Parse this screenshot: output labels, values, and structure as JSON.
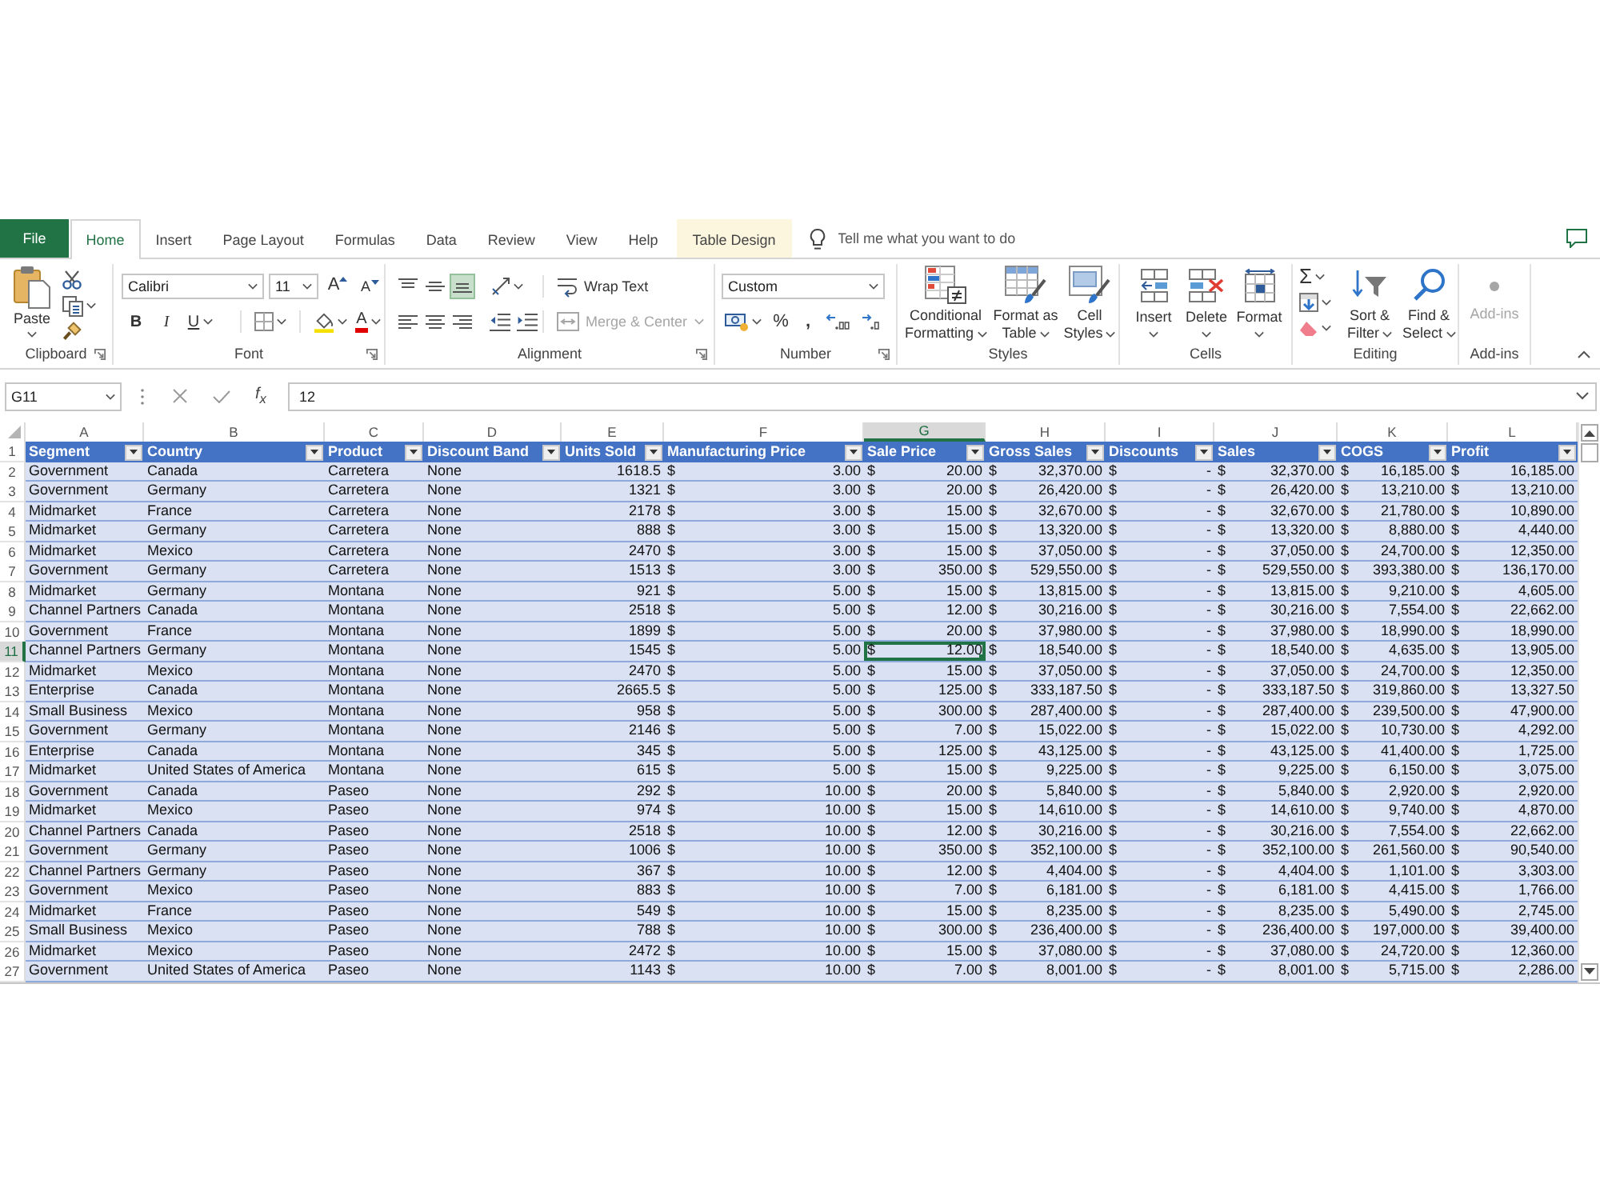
{
  "tabs": [
    {
      "label": "File",
      "kind": "file",
      "selected": false
    },
    {
      "label": "Home",
      "kind": "standard",
      "selected": true
    },
    {
      "label": "Insert",
      "kind": "standard",
      "selected": false
    },
    {
      "label": "Page Layout",
      "kind": "standard",
      "selected": false
    },
    {
      "label": "Formulas",
      "kind": "standard",
      "selected": false
    },
    {
      "label": "Data",
      "kind": "standard",
      "selected": false
    },
    {
      "label": "Review",
      "kind": "standard",
      "selected": false
    },
    {
      "label": "View",
      "kind": "standard",
      "selected": false
    },
    {
      "label": "Help",
      "kind": "standard",
      "selected": false
    },
    {
      "label": "Table Design",
      "kind": "contextual",
      "selected": false
    }
  ],
  "tell_me": {
    "placeholder": "Tell me what you want to do"
  },
  "ribbon": {
    "clipboard": {
      "label": "Clipboard",
      "paste": "Paste"
    },
    "font": {
      "label": "Font",
      "font_name": "Calibri",
      "font_size": "11",
      "grow_font": "A",
      "shrink_font": "A",
      "bold": "B",
      "italic": "I",
      "underline": "U",
      "font_color": "A"
    },
    "alignment": {
      "label": "Alignment",
      "vertical": [
        {
          "selected": false
        },
        {
          "selected": false
        },
        {
          "selected": true
        }
      ],
      "horizontal": [
        {
          "selected": false
        },
        {
          "selected": false
        },
        {
          "selected": false
        }
      ],
      "wrap_text": "Wrap Text",
      "merge_center": {
        "label": "Merge & Center",
        "disabled": true
      }
    },
    "number": {
      "label": "Number",
      "format": "Custom",
      "percent": "%",
      "comma": ","
    },
    "styles": {
      "label": "Styles",
      "buttons": [
        "Conditional Formatting",
        "Format as Table",
        "Cell Styles"
      ]
    },
    "cells": {
      "label": "Cells",
      "buttons": [
        "Insert",
        "Delete",
        "Format"
      ]
    },
    "editing": {
      "label": "Editing",
      "autosum": "Σ",
      "sort_filter": "Sort & Filter",
      "find_select": "Find & Select"
    },
    "add_ins": {
      "label": "Add-ins",
      "button": {
        "label": "Add-ins",
        "disabled": true
      }
    }
  },
  "formula_bar": {
    "name_box": "G11",
    "fx": "f$_{x}$",
    "formula": "12"
  },
  "sheet": {
    "columns": [
      {
        "letter": "A",
        "header": "Segment",
        "kind": "text",
        "selected": false
      },
      {
        "letter": "B",
        "header": "Country",
        "kind": "text",
        "selected": false
      },
      {
        "letter": "C",
        "header": "Product",
        "kind": "text",
        "selected": false
      },
      {
        "letter": "D",
        "header": "Discount Band",
        "kind": "text",
        "selected": false
      },
      {
        "letter": "E",
        "header": "Units Sold",
        "kind": "number",
        "selected": false
      },
      {
        "letter": "F",
        "header": "Manufacturing Price",
        "kind": "currency",
        "selected": false
      },
      {
        "letter": "G",
        "header": "Sale Price",
        "kind": "currency",
        "selected": true
      },
      {
        "letter": "H",
        "header": "Gross Sales",
        "kind": "currency",
        "selected": false
      },
      {
        "letter": "I",
        "header": "Discounts",
        "kind": "currency",
        "selected": false
      },
      {
        "letter": "J",
        "header": "Sales",
        "kind": "currency",
        "selected": false
      },
      {
        "letter": "K",
        "header": "COGS",
        "kind": "currency",
        "selected": false
      },
      {
        "letter": "L",
        "header": "Profit",
        "kind": "currency",
        "selected": false
      }
    ],
    "header_row_number": "1",
    "rows": [
      {
        "number": "2",
        "selected": false,
        "cells": [
          "Government",
          "Canada",
          "Carretera",
          "None",
          "1618.5",
          "$ 3.00",
          "$ 20.00",
          "$ 32,370.00",
          "$ -",
          "$ 32,370.00",
          "$ 16,185.00",
          "$ 16,185.00"
        ]
      },
      {
        "number": "3",
        "selected": false,
        "cells": [
          "Government",
          "Germany",
          "Carretera",
          "None",
          "1321",
          "$ 3.00",
          "$ 20.00",
          "$ 26,420.00",
          "$ -",
          "$ 26,420.00",
          "$ 13,210.00",
          "$ 13,210.00"
        ]
      },
      {
        "number": "4",
        "selected": false,
        "cells": [
          "Midmarket",
          "France",
          "Carretera",
          "None",
          "2178",
          "$ 3.00",
          "$ 15.00",
          "$ 32,670.00",
          "$ -",
          "$ 32,670.00",
          "$ 21,780.00",
          "$ 10,890.00"
        ]
      },
      {
        "number": "5",
        "selected": false,
        "cells": [
          "Midmarket",
          "Germany",
          "Carretera",
          "None",
          "888",
          "$ 3.00",
          "$ 15.00",
          "$ 13,320.00",
          "$ -",
          "$ 13,320.00",
          "$ 8,880.00",
          "$ 4,440.00"
        ]
      },
      {
        "number": "6",
        "selected": false,
        "cells": [
          "Midmarket",
          "Mexico",
          "Carretera",
          "None",
          "2470",
          "$ 3.00",
          "$ 15.00",
          "$ 37,050.00",
          "$ -",
          "$ 37,050.00",
          "$ 24,700.00",
          "$ 12,350.00"
        ]
      },
      {
        "number": "7",
        "selected": false,
        "cells": [
          "Government",
          "Germany",
          "Carretera",
          "None",
          "1513",
          "$ 3.00",
          "$ 350.00",
          "$ 529,550.00",
          "$ -",
          "$ 529,550.00",
          "$ 393,380.00",
          "$ 136,170.00"
        ]
      },
      {
        "number": "8",
        "selected": false,
        "cells": [
          "Midmarket",
          "Germany",
          "Montana",
          "None",
          "921",
          "$ 5.00",
          "$ 15.00",
          "$ 13,815.00",
          "$ -",
          "$ 13,815.00",
          "$ 9,210.00",
          "$ 4,605.00"
        ]
      },
      {
        "number": "9",
        "selected": false,
        "cells": [
          "Channel Partners",
          "Canada",
          "Montana",
          "None",
          "2518",
          "$ 5.00",
          "$ 12.00",
          "$ 30,216.00",
          "$ -",
          "$ 30,216.00",
          "$ 7,554.00",
          "$ 22,662.00"
        ]
      },
      {
        "number": "10",
        "selected": false,
        "cells": [
          "Government",
          "France",
          "Montana",
          "None",
          "1899",
          "$ 5.00",
          "$ 20.00",
          "$ 37,980.00",
          "$ -",
          "$ 37,980.00",
          "$ 18,990.00",
          "$ 18,990.00"
        ]
      },
      {
        "number": "11",
        "selected": true,
        "cells": [
          "Channel Partners",
          "Germany",
          "Montana",
          "None",
          "1545",
          "$ 5.00",
          "$ 12.00",
          "$ 18,540.00",
          "$ -",
          "$ 18,540.00",
          "$ 4,635.00",
          "$ 13,905.00"
        ]
      },
      {
        "number": "12",
        "selected": false,
        "cells": [
          "Midmarket",
          "Mexico",
          "Montana",
          "None",
          "2470",
          "$ 5.00",
          "$ 15.00",
          "$ 37,050.00",
          "$ -",
          "$ 37,050.00",
          "$ 24,700.00",
          "$ 12,350.00"
        ]
      },
      {
        "number": "13",
        "selected": false,
        "cells": [
          "Enterprise",
          "Canada",
          "Montana",
          "None",
          "2665.5",
          "$ 5.00",
          "$ 125.00",
          "$ 333,187.50",
          "$ -",
          "$ 333,187.50",
          "$ 319,860.00",
          "$ 13,327.50"
        ]
      },
      {
        "number": "14",
        "selected": false,
        "cells": [
          "Small Business",
          "Mexico",
          "Montana",
          "None",
          "958",
          "$ 5.00",
          "$ 300.00",
          "$ 287,400.00",
          "$ -",
          "$ 287,400.00",
          "$ 239,500.00",
          "$ 47,900.00"
        ]
      },
      {
        "number": "15",
        "selected": false,
        "cells": [
          "Government",
          "Germany",
          "Montana",
          "None",
          "2146",
          "$ 5.00",
          "$ 7.00",
          "$ 15,022.00",
          "$ -",
          "$ 15,022.00",
          "$ 10,730.00",
          "$ 4,292.00"
        ]
      },
      {
        "number": "16",
        "selected": false,
        "cells": [
          "Enterprise",
          "Canada",
          "Montana",
          "None",
          "345",
          "$ 5.00",
          "$ 125.00",
          "$ 43,125.00",
          "$ -",
          "$ 43,125.00",
          "$ 41,400.00",
          "$ 1,725.00"
        ]
      },
      {
        "number": "17",
        "selected": false,
        "cells": [
          "Midmarket",
          "United States of America",
          "Montana",
          "None",
          "615",
          "$ 5.00",
          "$ 15.00",
          "$ 9,225.00",
          "$ -",
          "$ 9,225.00",
          "$ 6,150.00",
          "$ 3,075.00"
        ]
      },
      {
        "number": "18",
        "selected": false,
        "cells": [
          "Government",
          "Canada",
          "Paseo",
          "None",
          "292",
          "$ 10.00",
          "$ 20.00",
          "$ 5,840.00",
          "$ -",
          "$ 5,840.00",
          "$ 2,920.00",
          "$ 2,920.00"
        ]
      },
      {
        "number": "19",
        "selected": false,
        "cells": [
          "Midmarket",
          "Mexico",
          "Paseo",
          "None",
          "974",
          "$ 10.00",
          "$ 15.00",
          "$ 14,610.00",
          "$ -",
          "$ 14,610.00",
          "$ 9,740.00",
          "$ 4,870.00"
        ]
      },
      {
        "number": "20",
        "selected": false,
        "cells": [
          "Channel Partners",
          "Canada",
          "Paseo",
          "None",
          "2518",
          "$ 10.00",
          "$ 12.00",
          "$ 30,216.00",
          "$ -",
          "$ 30,216.00",
          "$ 7,554.00",
          "$ 22,662.00"
        ]
      },
      {
        "number": "21",
        "selected": false,
        "cells": [
          "Government",
          "Germany",
          "Paseo",
          "None",
          "1006",
          "$ 10.00",
          "$ 350.00",
          "$ 352,100.00",
          "$ -",
          "$ 352,100.00",
          "$ 261,560.00",
          "$ 90,540.00"
        ]
      },
      {
        "number": "22",
        "selected": false,
        "cells": [
          "Channel Partners",
          "Germany",
          "Paseo",
          "None",
          "367",
          "$ 10.00",
          "$ 12.00",
          "$ 4,404.00",
          "$ -",
          "$ 4,404.00",
          "$ 1,101.00",
          "$ 3,303.00"
        ]
      },
      {
        "number": "23",
        "selected": false,
        "cells": [
          "Government",
          "Mexico",
          "Paseo",
          "None",
          "883",
          "$ 10.00",
          "$ 7.00",
          "$ 6,181.00",
          "$ -",
          "$ 6,181.00",
          "$ 4,415.00",
          "$ 1,766.00"
        ]
      },
      {
        "number": "24",
        "selected": false,
        "cells": [
          "Midmarket",
          "France",
          "Paseo",
          "None",
          "549",
          "$ 10.00",
          "$ 15.00",
          "$ 8,235.00",
          "$ -",
          "$ 8,235.00",
          "$ 5,490.00",
          "$ 2,745.00"
        ]
      },
      {
        "number": "25",
        "selected": false,
        "cells": [
          "Small Business",
          "Mexico",
          "Paseo",
          "None",
          "788",
          "$ 10.00",
          "$ 300.00",
          "$ 236,400.00",
          "$ -",
          "$ 236,400.00",
          "$ 197,000.00",
          "$ 39,400.00"
        ]
      },
      {
        "number": "26",
        "selected": false,
        "cells": [
          "Midmarket",
          "Mexico",
          "Paseo",
          "None",
          "2472",
          "$ 10.00",
          "$ 15.00",
          "$ 37,080.00",
          "$ -",
          "$ 37,080.00",
          "$ 24,720.00",
          "$ 12,360.00"
        ]
      },
      {
        "number": "27",
        "selected": false,
        "cells": [
          "Government",
          "United States of America",
          "Paseo",
          "None",
          "1143",
          "$ 10.00",
          "$ 7.00",
          "$ 8,001.00",
          "$ -",
          "$ 8,001.00",
          "$ 5,715.00",
          "$ 2,286.00"
        ]
      }
    ]
  }
}
